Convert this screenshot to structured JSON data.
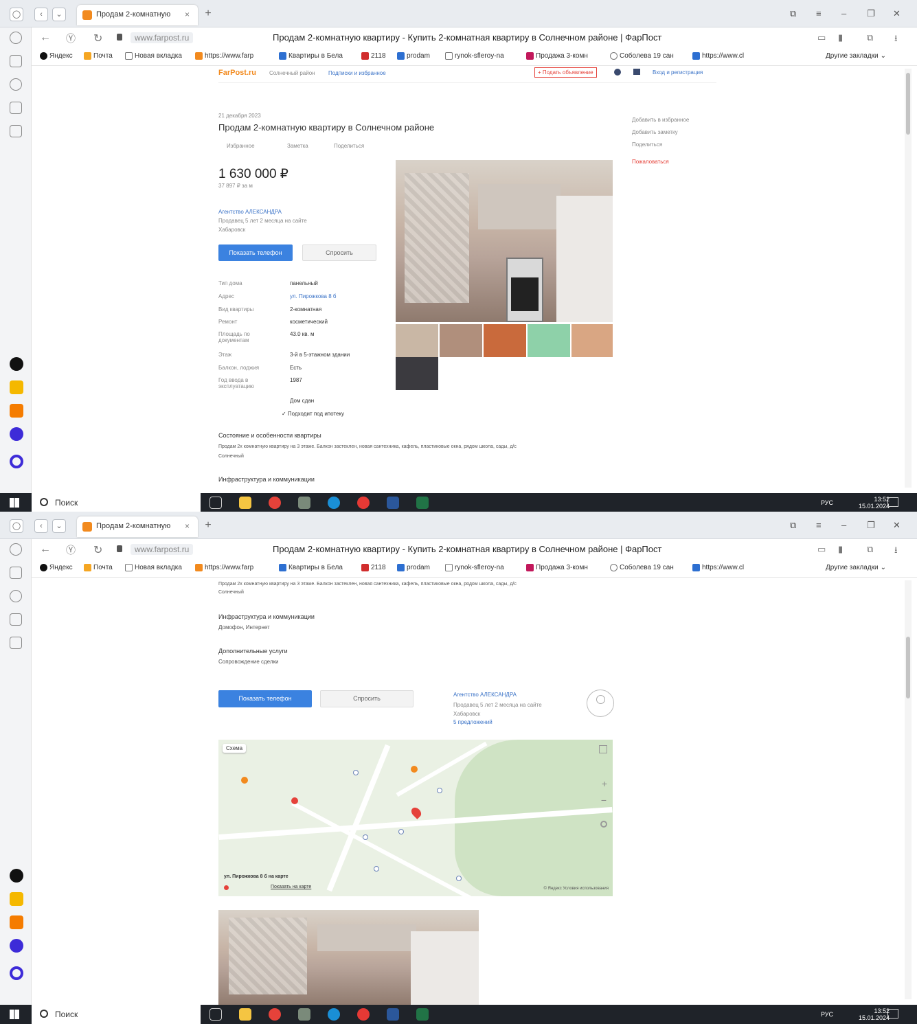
{
  "browser": {
    "tab_title": "Продам 2-комнатную",
    "domain": "www.farpost.ru",
    "page_title": "Продам 2-комнатную квартиру - Купить 2-комнатная квартиру в Солнечном районе | ФарПост",
    "bookmarks": [
      "Яндекс",
      "Почта",
      "Новая вкладка",
      "https://www.farp",
      "Квартиры в Бела",
      "2118",
      "prodam",
      "rynok-sfleroy-na",
      "Продажа 3-комн",
      "Соболева 19 сан",
      "https://www.cl"
    ],
    "bookmarks_more": "Другие закладки",
    "new_tab_symbol": "+",
    "close_symbol": "×"
  },
  "site": {
    "logo": "FarPost.ru",
    "nav_items": [
      "Солнечный район",
      "Подписки и избранное"
    ],
    "post_ad": "+ Подать объявление",
    "login": "Вход и регистрация"
  },
  "listing": {
    "date": "21 декабря 2023",
    "title": "Продам 2-комнатную квартиру в Солнечном районе",
    "actions": [
      "Избранное",
      "Заметка",
      "Поделиться"
    ],
    "price": "1 630 000 ₽",
    "price_per_m": "37 897 ₽ за м",
    "seller_name": "Агентство АЛЕКСАНДРА",
    "seller_meta": "Продавец 5 лет 2 месяца на сайте",
    "seller_city": "Хабаровск",
    "show_phone": "Показать телефон",
    "ask": "Спросить",
    "side_actions": [
      "Добавить в избранное",
      "Добавить заметку",
      "Поделиться",
      "Пожаловаться"
    ],
    "params": [
      {
        "label": "Тип дома",
        "value": "панельный"
      },
      {
        "label": "Адрес",
        "value": "ул. Пирожкова 8 б"
      },
      {
        "label": "Вид квартиры",
        "value": "2-комнатная"
      },
      {
        "label": "Ремонт",
        "value": "косметический"
      },
      {
        "label": "Площадь по документам",
        "value": "43.0 кв. м"
      },
      {
        "label": "Этаж",
        "value": "3-й в 5-этажном здании"
      },
      {
        "label": "Балкон, лоджия",
        "value": "Есть"
      },
      {
        "label": "Год ввода в эксплуатацию",
        "value": "1987"
      }
    ],
    "extra_1": "Дом сдан",
    "extra_2": "✓ Подходит под ипотеку",
    "desc_heading": "Состояние и особенности квартиры",
    "desc_text": "Продам 2х комнатную квартиру на 3 этаже. Балкон застеклен, новая сантехника, кафель, пластиковые окна, рядом школа, сады, д/с",
    "desc_text_2": "Солнечный",
    "infra_heading": "Инфраструктура и коммуникации",
    "infra_text": "Домофон, Интернет",
    "services_heading": "Дополнительные услуги",
    "services_text": "Сопровождение сделки",
    "seller_offers": "5 предложений",
    "map_caption": "ул. Пирожкова 8 б на карте",
    "map_link": "Показать на карте",
    "map_layer": "Схема",
    "map_credits": "© Яндекс  Условия использования"
  },
  "taskbar": {
    "search": "Поиск",
    "lang": "РУС",
    "time": "13:52",
    "date": "15.01.2024"
  },
  "colors": {
    "accent_blue": "#3b82e0",
    "brand_orange": "#f28a1e",
    "alert_red": "#e5423a"
  }
}
